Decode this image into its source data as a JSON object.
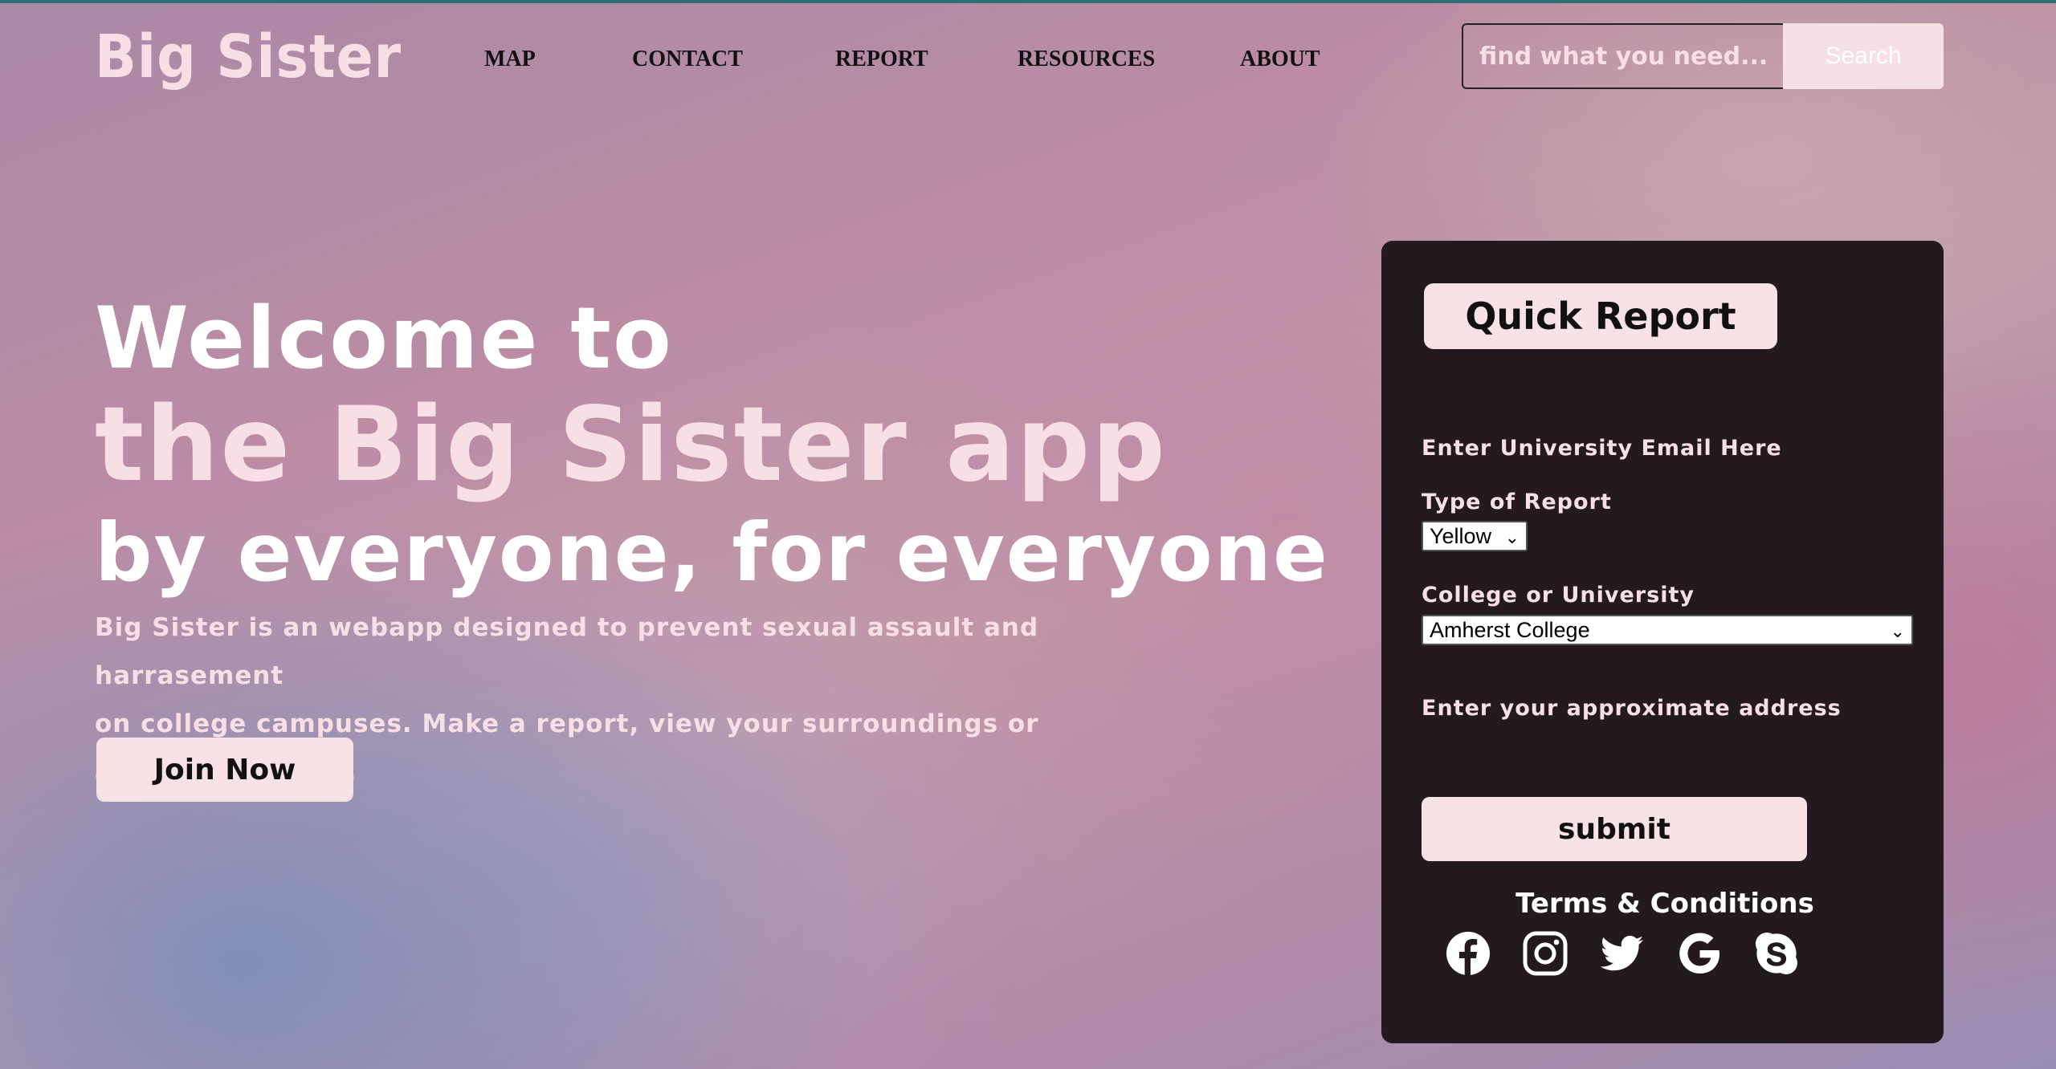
{
  "header": {
    "logo": "Big Sister",
    "nav": [
      {
        "label": "MAP"
      },
      {
        "label": "CONTACT"
      },
      {
        "label": "REPORT"
      },
      {
        "label": "RESOURCES"
      },
      {
        "label": "ABOUT"
      }
    ],
    "search": {
      "placeholder": "find what you need...",
      "button_label": "Search"
    }
  },
  "hero": {
    "line1": "Welcome to",
    "line2": "the Big Sister app",
    "line3": "by everyone, for everyone",
    "description_line1": "Big Sister is an webapp designed to prevent sexual assault and harrasement",
    "description_line2": "on college campuses. Make a report, view your surroundings or access resources.",
    "join_label": "Join Now"
  },
  "quick_report": {
    "title": "Quick Report",
    "email_placeholder": "Enter University Email Here",
    "type_label": "Type of Report",
    "type_value": "Yellow",
    "college_label": "College or University",
    "college_value": "Amherst College",
    "address_placeholder": "Enter your approximate address",
    "submit_label": "submit",
    "terms_label": "Terms & Conditions",
    "social_icons": [
      "facebook-icon",
      "instagram-icon",
      "twitter-icon",
      "google-icon",
      "skype-icon"
    ]
  },
  "colors": {
    "accent_pink": "#f8e2e6",
    "panel_bg": "#231a1f",
    "text_dark": "#111111"
  }
}
